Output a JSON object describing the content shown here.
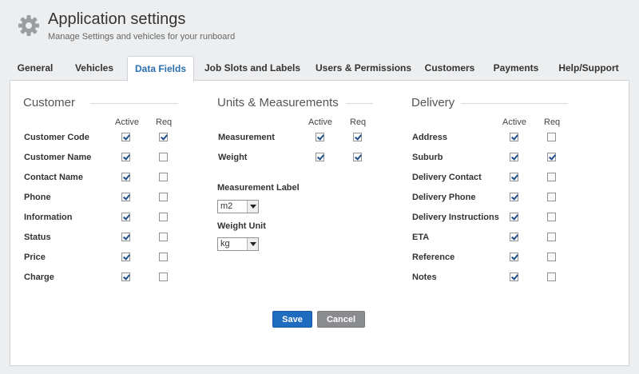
{
  "header": {
    "title": "Application settings",
    "subtitle": "Manage Settings and vehicles for your runboard",
    "icon": "gear-icon"
  },
  "tabs": [
    {
      "label": "General",
      "active": false
    },
    {
      "label": "Vehicles",
      "active": false
    },
    {
      "label": "Data Fields",
      "active": true
    },
    {
      "label": "Job Slots and Labels",
      "active": false
    },
    {
      "label": "Users & Permissions",
      "active": false
    },
    {
      "label": "Customers",
      "active": false
    },
    {
      "label": "Payments",
      "active": false
    },
    {
      "label": "Help/Support",
      "active": false
    }
  ],
  "customer": {
    "title": "Customer",
    "active_label": "Active",
    "req_label": "Req",
    "rows": [
      {
        "label": "Customer Code",
        "active": true,
        "req": true
      },
      {
        "label": "Customer Name",
        "active": true,
        "req": false
      },
      {
        "label": "Contact Name",
        "active": true,
        "req": false
      },
      {
        "label": "Phone",
        "active": true,
        "req": false
      },
      {
        "label": "Information",
        "active": true,
        "req": false
      },
      {
        "label": "Status",
        "active": true,
        "req": false
      },
      {
        "label": "Price",
        "active": true,
        "req": false
      },
      {
        "label": "Charge",
        "active": true,
        "req": false
      }
    ]
  },
  "units": {
    "title": "Units & Measurements",
    "active_label": "Active",
    "req_label": "Req",
    "rows": [
      {
        "label": "Measurement",
        "active": true,
        "req": true
      },
      {
        "label": "Weight",
        "active": true,
        "req": true
      }
    ],
    "measurement_label": {
      "label": "Measurement Label",
      "value": "m2"
    },
    "weight_unit": {
      "label": "Weight Unit",
      "value": "kg"
    }
  },
  "delivery": {
    "title": "Delivery",
    "active_label": "Active",
    "req_label": "Req",
    "rows": [
      {
        "label": "Address",
        "active": true,
        "req": false
      },
      {
        "label": "Suburb",
        "active": true,
        "req": true
      },
      {
        "label": "Delivery Contact",
        "active": true,
        "req": false
      },
      {
        "label": "Delivery Phone",
        "active": true,
        "req": false
      },
      {
        "label": "Delivery Instructions",
        "active": true,
        "req": false
      },
      {
        "label": "ETA",
        "active": true,
        "req": false
      },
      {
        "label": "Reference",
        "active": true,
        "req": false
      },
      {
        "label": "Notes",
        "active": true,
        "req": false
      }
    ]
  },
  "actions": {
    "save_label": "Save",
    "cancel_label": "Cancel"
  },
  "colors": {
    "accent": "#2b6fae",
    "save": "#1e6bbf",
    "cancel": "#8a8c8f"
  }
}
